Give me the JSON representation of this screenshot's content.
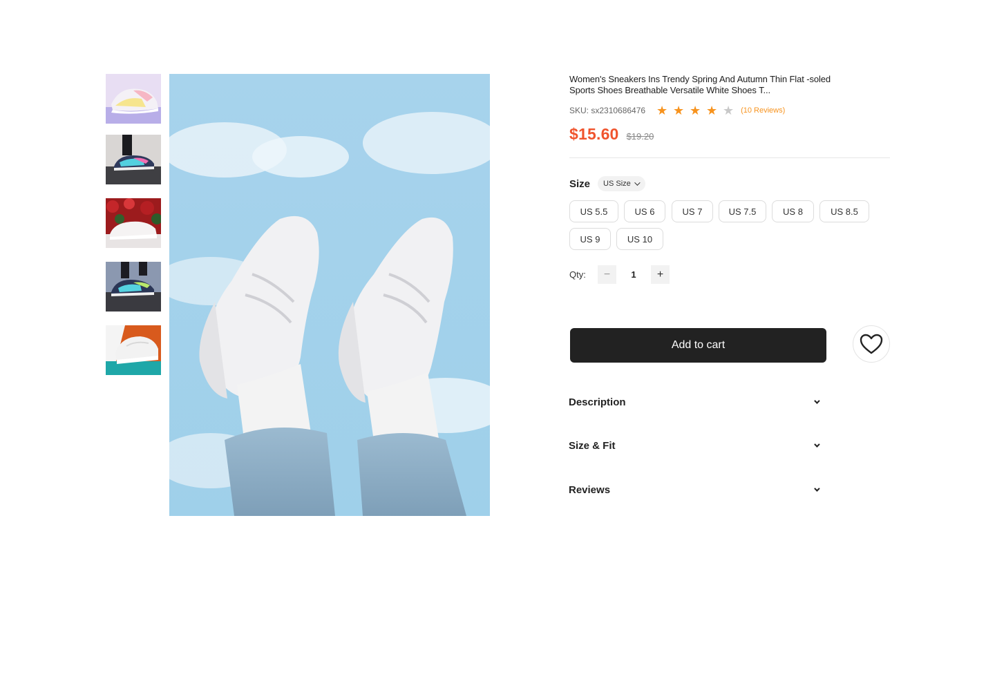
{
  "product": {
    "title": "Women's Sneakers Ins Trendy Spring And Autumn Thin Flat -soled Sports Shoes Breathable Versatile White Shoes T...",
    "sku": "SKU: sx2310686476",
    "rating": 4,
    "rating_max": 5,
    "reviews_label": "(10 Reviews)",
    "price": "$15.60",
    "old_price": "$19.20"
  },
  "size": {
    "label": "Size",
    "unit_select": "US Size",
    "options": [
      "US 5.5",
      "US 6",
      "US 7",
      "US 7.5",
      "US 8",
      "US 8.5",
      "US 9",
      "US 10"
    ]
  },
  "quantity": {
    "label": "Qty:",
    "value": "1",
    "minus": "−",
    "plus": "+"
  },
  "actions": {
    "add_to_cart": "Add to cart"
  },
  "accordions": [
    {
      "label": "Description"
    },
    {
      "label": "Size & Fit"
    },
    {
      "label": "Reviews"
    }
  ],
  "colors": {
    "price": "#f0542d",
    "star": "#f7931e",
    "button": "#222222"
  },
  "icons": {
    "wishlist": "heart-icon",
    "chevron": "chevron-down-icon",
    "rating": "star-icon"
  }
}
